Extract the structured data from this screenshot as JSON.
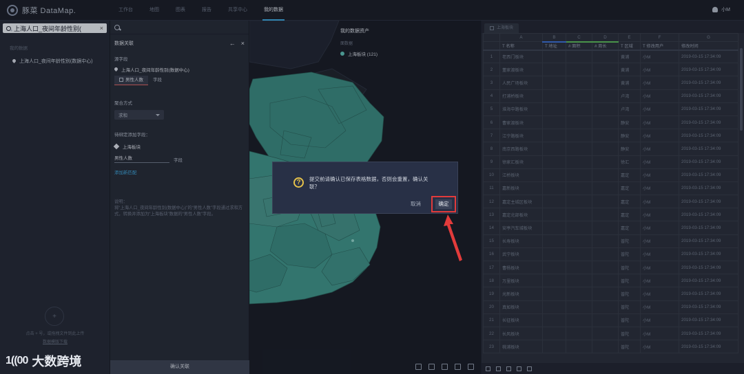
{
  "app": {
    "logo_text": "豚菜 DataMap.",
    "nav": [
      "工作台",
      "地图",
      "图表",
      "报告",
      "共享中心",
      "我的数据"
    ],
    "user_name": "小M"
  },
  "sidebar": {
    "search_value": "上海人口_夜间年龄性别(",
    "section_title": "我的数据",
    "item": "上海人口_夜间年龄性别(数据中心)",
    "upload_hint_1": "点击 + 号，或拖拽文件到此上传",
    "upload_hint_2": "数据模版下载"
  },
  "panel": {
    "title": "数据关联",
    "source_label": "源字段",
    "source_value": "上海人口_夜间年龄性别(数据中心)",
    "tab_active": "男性人数",
    "tab_other": "字段",
    "agg_label": "聚合方式",
    "agg_value": "求和",
    "target_label": "待绑定添加字段：",
    "target_layer": "上海板块",
    "field_name": "男性人数",
    "field_unit": "字段",
    "add_link": "添加新匹配",
    "desc_title": "说明：",
    "desc_body": "将“上海人口_夜间年龄性别(数据中心)”的“男性人数”字段通过求和方式，转换并添加为“上海板块”数据的“男性人数”字段。",
    "confirm_button": "确认关联"
  },
  "map": {
    "assets_title": "我的数据资产",
    "assets_sub": "面数据",
    "assets_item": "上海板块 (121)",
    "region_color": "#3f8f87"
  },
  "sheet": {
    "tab_label": "上海板块",
    "col_letters": [
      "A",
      "B",
      "C",
      "D",
      "E",
      "F",
      "G"
    ],
    "headers": [
      "T 名称",
      "T 地址",
      "# 面积",
      "# 周长",
      "T 区域",
      "T 修改用户",
      "修改时间"
    ],
    "rows": [
      [
        "1",
        "老西门板块",
        "",
        "",
        "",
        "黄浦",
        "小M",
        "2019-03-15 17:34:09"
      ],
      [
        "2",
        "董家渡板块",
        "",
        "",
        "",
        "黄浦",
        "小M",
        "2019-03-15 17:34:09"
      ],
      [
        "3",
        "人民广场板块",
        "",
        "",
        "",
        "黄浦",
        "小M",
        "2019-03-15 17:34:09"
      ],
      [
        "4",
        "打浦桥板块",
        "",
        "",
        "",
        "卢湾",
        "小M",
        "2019-03-15 17:34:09"
      ],
      [
        "5",
        "淮海中路板块",
        "",
        "",
        "",
        "卢湾",
        "小M",
        "2019-03-15 17:34:09"
      ],
      [
        "6",
        "曹家渡板块",
        "",
        "",
        "",
        "静安",
        "小M",
        "2019-03-15 17:34:09"
      ],
      [
        "7",
        "江宁路板块",
        "",
        "",
        "",
        "静安",
        "小M",
        "2019-03-15 17:34:09"
      ],
      [
        "8",
        "南京西路板块",
        "",
        "",
        "",
        "静安",
        "小M",
        "2019-03-15 17:34:09"
      ],
      [
        "9",
        "徐家汇板块",
        "",
        "",
        "",
        "徐汇",
        "小M",
        "2019-03-15 17:34:09"
      ],
      [
        "10",
        "江桥板块",
        "",
        "",
        "",
        "嘉定",
        "小M",
        "2019-03-15 17:34:09"
      ],
      [
        "11",
        "嘉新板块",
        "",
        "",
        "",
        "嘉定",
        "小M",
        "2019-03-15 17:34:09"
      ],
      [
        "12",
        "嘉定主城区板块",
        "",
        "",
        "",
        "嘉定",
        "小M",
        "2019-03-15 17:34:09"
      ],
      [
        "13",
        "嘉定北部板块",
        "",
        "",
        "",
        "嘉定",
        "小M",
        "2019-03-15 17:34:09"
      ],
      [
        "14",
        "安亭汽车城板块",
        "",
        "",
        "",
        "嘉定",
        "小M",
        "2019-03-15 17:34:09"
      ],
      [
        "15",
        "长寿板块",
        "",
        "",
        "",
        "普陀",
        "小M",
        "2019-03-15 17:34:09"
      ],
      [
        "16",
        "武宁板块",
        "",
        "",
        "",
        "普陀",
        "小M",
        "2019-03-15 17:34:09"
      ],
      [
        "17",
        "曹杨板块",
        "",
        "",
        "",
        "普陀",
        "小M",
        "2019-03-15 17:34:09"
      ],
      [
        "18",
        "万里板块",
        "",
        "",
        "",
        "普陀",
        "小M",
        "2019-03-15 17:34:09"
      ],
      [
        "19",
        "光新板块",
        "",
        "",
        "",
        "普陀",
        "小M",
        "2019-03-15 17:34:09"
      ],
      [
        "20",
        "真如板块",
        "",
        "",
        "",
        "普陀",
        "小M",
        "2019-03-15 17:34:09"
      ],
      [
        "21",
        "长征板块",
        "",
        "",
        "",
        "普陀",
        "小M",
        "2019-03-15 17:34:09"
      ],
      [
        "22",
        "长风板块",
        "",
        "",
        "",
        "普陀",
        "小M",
        "2019-03-15 17:34:09"
      ],
      [
        "23",
        "桃浦板块",
        "",
        "",
        "",
        "普陀",
        "小M",
        "2019-03-15 17:34:09"
      ]
    ]
  },
  "dialog": {
    "message": "提交前请确认已保存表格数据，否则会重置，确认关联？",
    "cancel": "取消",
    "ok": "确定"
  },
  "watermark": {
    "mark": "1((00",
    "text": "大数跨境"
  }
}
